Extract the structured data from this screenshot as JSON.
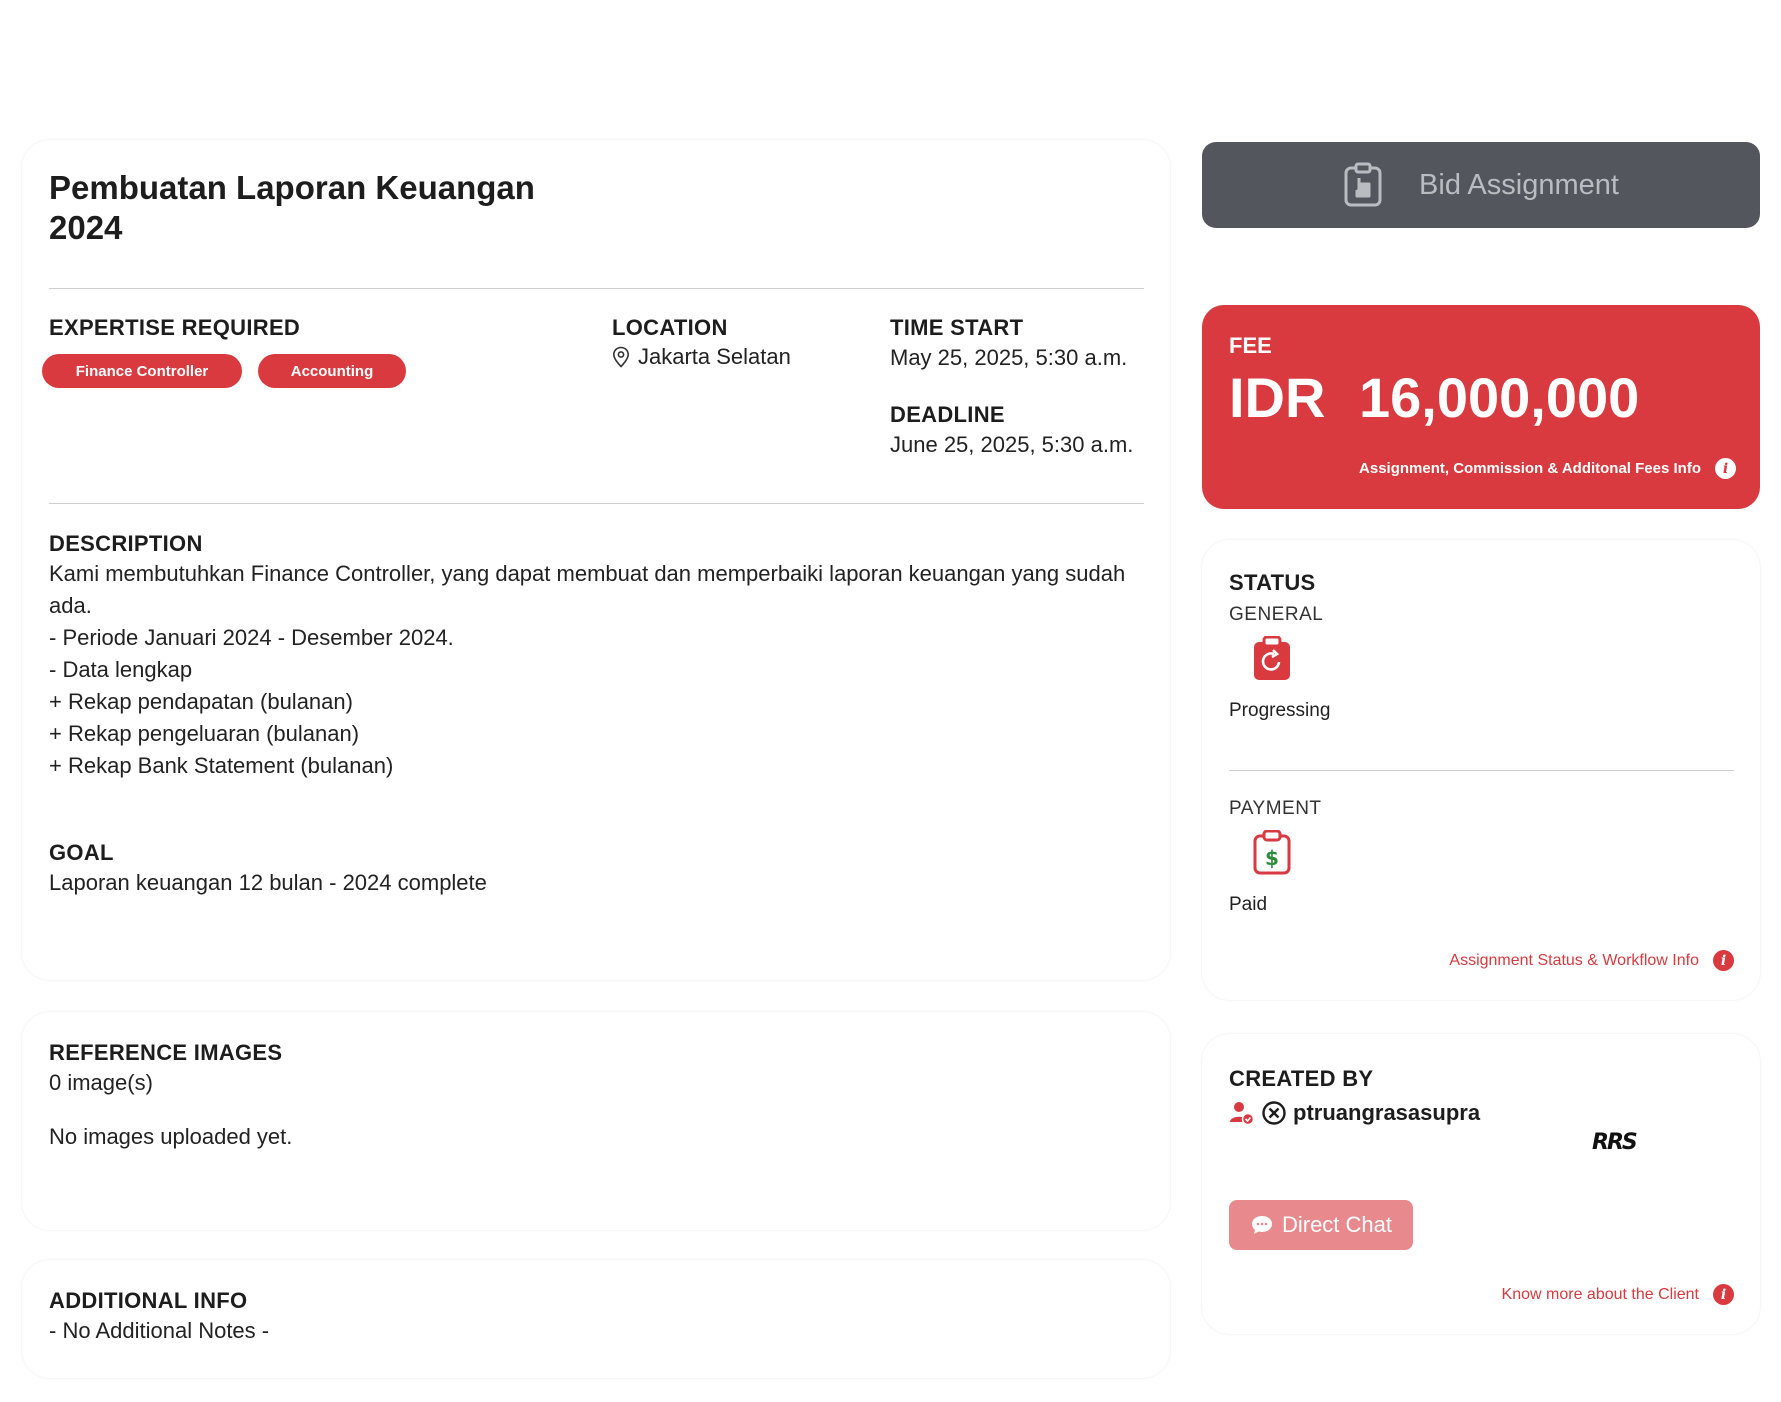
{
  "assignment": {
    "title": "Pembuatan Laporan Keuangan 2024",
    "expertise_label": "EXPERTISE REQUIRED",
    "tags": [
      "Finance Controller",
      "Accounting"
    ],
    "location_label": "LOCATION",
    "location": "Jakarta Selatan",
    "time_start_label": "TIME START",
    "time_start": "May 25, 2025, 5:30 a.m.",
    "deadline_label": "DEADLINE",
    "deadline": "June 25, 2025, 5:30 a.m.",
    "description_label": "DESCRIPTION",
    "description": "Kami membutuhkan Finance Controller, yang dapat membuat dan memperbaiki laporan keuangan yang sudah ada.\n- Periode Januari 2024 - Desember 2024.\n- Data lengkap\n+ Rekap pendapatan (bulanan)\n+ Rekap pengeluaran (bulanan)\n+ Rekap Bank Statement (bulanan)",
    "goal_label": "GOAL",
    "goal": "Laporan keuangan 12 bulan - 2024 complete"
  },
  "reference": {
    "label": "REFERENCE IMAGES",
    "count": "0 image(s)",
    "empty": "No images uploaded yet."
  },
  "additional": {
    "label": "ADDITIONAL INFO",
    "text": "- No Additional Notes -"
  },
  "bid": {
    "label": "Bid Assignment"
  },
  "fee": {
    "label": "FEE",
    "amount": "IDR 16,000,000",
    "info": "Assignment, Commission & Additonal Fees Info"
  },
  "status": {
    "label": "STATUS",
    "general_label": "GENERAL",
    "general_value": "Progressing",
    "payment_label": "PAYMENT",
    "payment_value": "Paid",
    "info": "Assignment Status & Workflow Info"
  },
  "created_by": {
    "label": "CREATED BY",
    "username": "ptruangrasasupra",
    "logo": "RRS",
    "chat_label": "Direct Chat",
    "info": "Know more about the Client"
  },
  "colors": {
    "accent": "#d83a3f",
    "bid_bg": "#53565c",
    "chat_bg": "#e88a8d"
  }
}
